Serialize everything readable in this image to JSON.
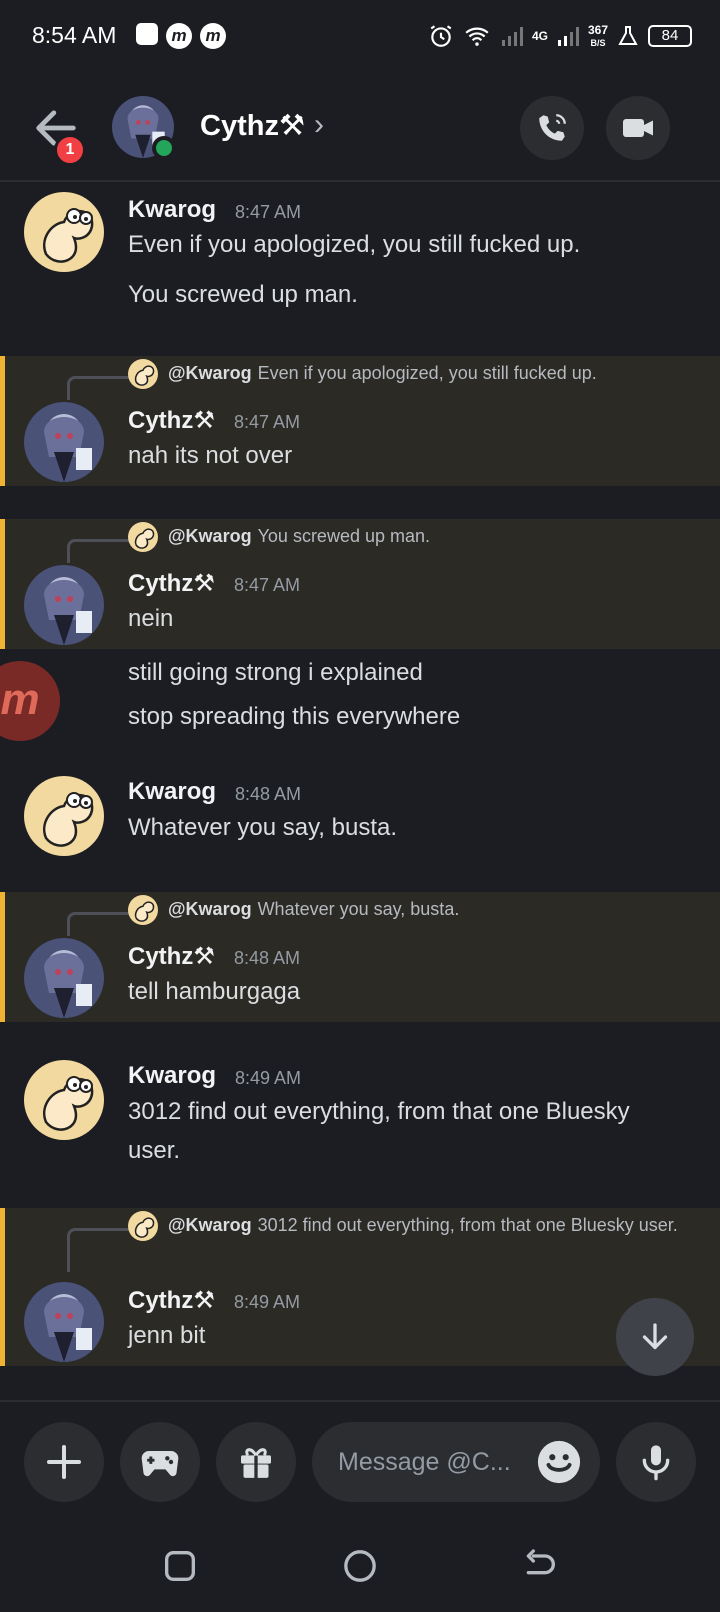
{
  "status_bar": {
    "time": "8:54 AM",
    "network_type": "4G",
    "speed_value": "367",
    "speed_unit": "B/S",
    "battery": "84"
  },
  "header": {
    "title": "Cythz⚒",
    "back_badge": "1"
  },
  "messages": [
    {
      "author": "Kwarog",
      "time": "8:47 AM",
      "lines": [
        "Even if you apologized, you still fucked up.",
        "You screwed up man."
      ]
    },
    {
      "reply_to": "@Kwarog",
      "reply_text": "Even if you apologized, you still fucked up.",
      "author": "Cythz⚒",
      "time": "8:47 AM",
      "lines": [
        "nah its not over"
      ]
    },
    {
      "reply_to": "@Kwarog",
      "reply_text": "You screwed up man.",
      "author": "Cythz⚒",
      "time": "8:47 AM",
      "lines": [
        "nein",
        "still going strong i explained",
        "stop spreading this everywhere"
      ]
    },
    {
      "author": "Kwarog",
      "time": "8:48 AM",
      "lines": [
        "Whatever you say, busta."
      ]
    },
    {
      "reply_to": "@Kwarog",
      "reply_text": "Whatever you say, busta.",
      "author": "Cythz⚒",
      "time": "8:48 AM",
      "lines": [
        "tell hamburgaga"
      ]
    },
    {
      "author": "Kwarog",
      "time": "8:49 AM",
      "lines": [
        "3012 find out everything, from that one Bluesky user."
      ]
    },
    {
      "reply_to": "@Kwarog",
      "reply_text": "3012 find out everything, from that one Bluesky user.",
      "author": "Cythz⚒",
      "time": "8:49 AM",
      "lines": [
        "jenn bit"
      ]
    }
  ],
  "composer": {
    "placeholder": "Message @C..."
  },
  "colors": {
    "background": "#1c1d22",
    "highlight": "#2c2a25",
    "highlight_border": "#f0b232",
    "online": "#23a55a",
    "badge": "#f23f43"
  }
}
